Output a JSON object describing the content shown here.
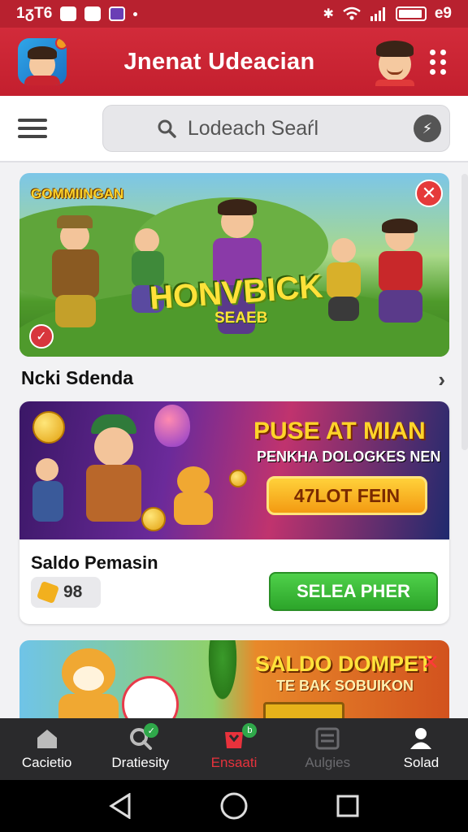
{
  "status_bar": {
    "time": "1ᵹT6",
    "battery": "e9"
  },
  "header": {
    "title": "Jnenat Udeacian"
  },
  "search": {
    "placeholder": "Lodeach Seaŕl"
  },
  "banner1": {
    "badge": "GOMMIINGAN",
    "title": "HONVBICK",
    "subtitle": "SEAEB"
  },
  "section": {
    "heading": "Ncki Sdenda"
  },
  "card2": {
    "promo_title": "PUSE AT MIAN",
    "promo_subtitle": "PENKHA DOLOGKES NEN",
    "promo_button": "47LOT FEIN",
    "title": "Saldo Pemasin",
    "balance": "98",
    "button": "SELEA PHER"
  },
  "card3": {
    "title": "SALDO DOMPET",
    "subtitle": "TE BAK SOBUIKON"
  },
  "bottom_nav": [
    {
      "label": "Cacietio",
      "icon": "home-icon",
      "state": "normal"
    },
    {
      "label": "Dratiesity",
      "icon": "search-icon",
      "state": "normal",
      "badge": "✓"
    },
    {
      "label": "Ensaati",
      "icon": "store-icon",
      "state": "active",
      "badge": "b"
    },
    {
      "label": "Aulgies",
      "icon": "list-icon",
      "state": "dim"
    },
    {
      "label": "Solad",
      "icon": "profile-icon",
      "state": "normal"
    }
  ],
  "colors": {
    "brand_red": "#c31f2e",
    "active_nav": "#e8323c",
    "select_green": "#2ca52a"
  }
}
